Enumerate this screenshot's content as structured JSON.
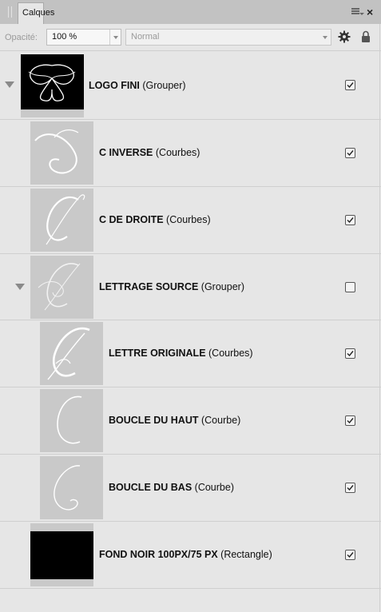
{
  "panel": {
    "tab_label": "Calques"
  },
  "toolbar": {
    "opacity_label": "Opacité:",
    "opacity_value": "100 %",
    "blend_mode": "Normal"
  },
  "layers": [
    {
      "name": "LOGO FINI",
      "type": "(Grouper)",
      "visible": true,
      "expanded": true
    },
    {
      "name": "C INVERSE",
      "type": "(Courbes)",
      "visible": true
    },
    {
      "name": "C DE DROITE",
      "type": "(Courbes)",
      "visible": true
    },
    {
      "name": "LETTRAGE SOURCE",
      "type": "(Grouper)",
      "visible": false,
      "expanded": true
    },
    {
      "name": "LETTRE ORIGINALE",
      "type": "(Courbes)",
      "visible": true
    },
    {
      "name": "BOUCLE DU HAUT",
      "type": "(Courbe)",
      "visible": true
    },
    {
      "name": "BOUCLE DU BAS",
      "type": "(Courbe)",
      "visible": true
    },
    {
      "name": "FOND NOIR 100PX/75 PX",
      "type": "(Rectangle)",
      "visible": true
    }
  ],
  "icons": {
    "grip": "grip-icon",
    "menu": "panel-menu-icon",
    "close": "close-icon",
    "gear": "gear-icon",
    "lock": "lock-icon",
    "expand": "expand-triangle-icon",
    "checkbox": "visibility-checkbox"
  }
}
